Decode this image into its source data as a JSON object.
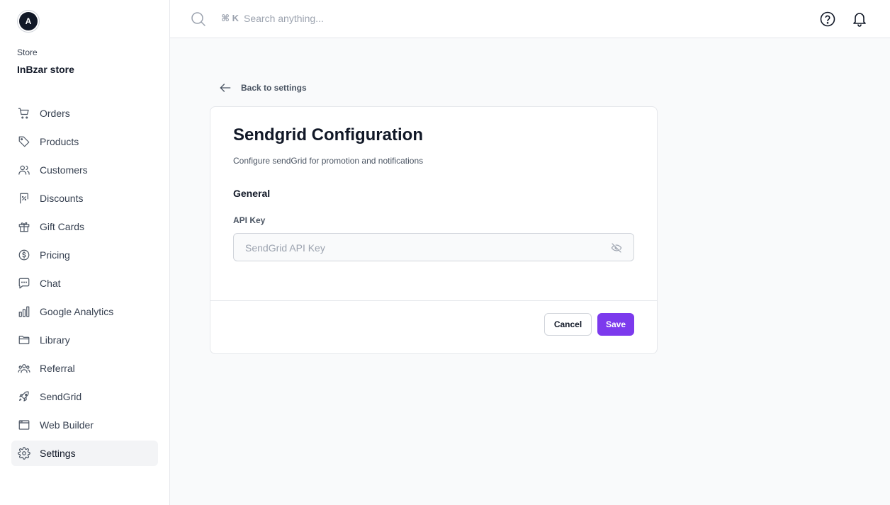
{
  "sidebar": {
    "avatar_letter": "A",
    "store_label": "Store",
    "store_name": "InBzar store",
    "items": [
      {
        "label": "Orders",
        "icon": "cart-icon"
      },
      {
        "label": "Products",
        "icon": "tag-icon"
      },
      {
        "label": "Customers",
        "icon": "users-icon"
      },
      {
        "label": "Discounts",
        "icon": "receipt-percent-icon"
      },
      {
        "label": "Gift Cards",
        "icon": "gift-icon"
      },
      {
        "label": "Pricing",
        "icon": "currency-dollar-icon"
      },
      {
        "label": "Chat",
        "icon": "chat-bubble-icon"
      },
      {
        "label": "Google Analytics",
        "icon": "chart-bar-icon"
      },
      {
        "label": "Library",
        "icon": "folder-icon"
      },
      {
        "label": "Referral",
        "icon": "user-group-icon"
      },
      {
        "label": "SendGrid",
        "icon": "rocket-icon"
      },
      {
        "label": "Web Builder",
        "icon": "browser-window-icon"
      },
      {
        "label": "Settings",
        "icon": "gear-icon",
        "active": true
      }
    ]
  },
  "topbar": {
    "shortcut": "⌘ K",
    "search_placeholder": "Search anything..."
  },
  "back_link": "Back to settings",
  "card": {
    "title": "Sendgrid Configuration",
    "subtitle": "Configure sendGrid for promotion and notifications",
    "section": "General",
    "api_key_label": "API Key",
    "api_key_placeholder": "SendGrid API Key",
    "api_key_value": "",
    "cancel_label": "Cancel",
    "save_label": "Save"
  },
  "colors": {
    "accent": "#7c3aed",
    "active_nav_bg": "#f3f4f6",
    "border": "#e5e7eb"
  }
}
